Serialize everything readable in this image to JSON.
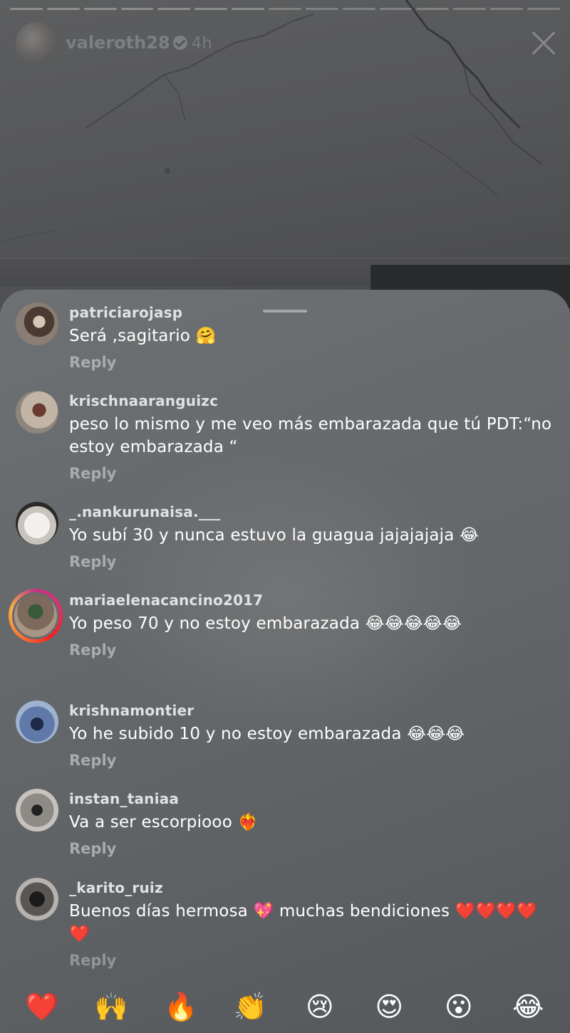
{
  "story": {
    "username": "valeroth28",
    "time": "4h",
    "segments": 15,
    "segments_done": 7
  },
  "comments": [
    {
      "user": "patriciarojasp",
      "text": "Será ,sagitario 🤗",
      "reply": "Reply",
      "avatar": "avatar-woman-hair"
    },
    {
      "user": "krischnaaranguizc",
      "text": "peso lo mismo y me veo más embarazada que tú PDT:“no estoy embarazada “",
      "reply": "Reply",
      "avatar": "avatar-woman-bedroom"
    },
    {
      "user": "_.nankurunaisa.___",
      "text": "Yo subí 30 y nunca estuvo la guagua jajajajaja 😂",
      "reply": "Reply",
      "avatar": "avatar-white-cat"
    },
    {
      "user": "mariaelenacancino2017",
      "text": "Yo peso 70 y no estoy embarazada 😂😂😂😂😂",
      "reply": "Reply",
      "avatar": "avatar-woman-story-ring"
    },
    {
      "user": "krishnamontier",
      "text": "Yo he subido 10 y no estoy embarazada 😂😂😂",
      "reply": "Reply",
      "avatar": "avatar-woman-outdoor"
    },
    {
      "user": "instan_taniaa",
      "text": "Va a ser escorpiooo ❤️‍🔥",
      "reply": "Reply",
      "avatar": "avatar-woman-standing"
    },
    {
      "user": "_karito_ruiz",
      "text": "Buenos días hermosa 💖  muchas bendiciones ❤️❤️❤️❤️❤️",
      "reply": "Reply",
      "avatar": "avatar-woman-dark"
    }
  ],
  "reactions": [
    "❤️",
    "🙌",
    "🔥",
    "👏",
    "😢",
    "😍",
    "😮",
    "😂"
  ],
  "icons": {
    "close": "close-icon",
    "verified": "verified-badge-icon"
  },
  "colors": {
    "sheet": "#686b6d",
    "username": "#dfe1e3",
    "reply": "#a9acae",
    "story_ring": "#e1306c"
  }
}
